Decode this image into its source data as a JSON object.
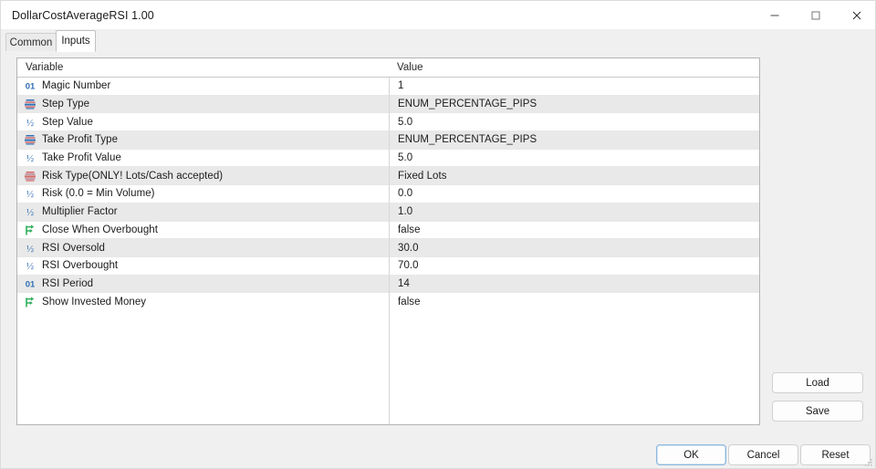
{
  "window": {
    "title": "DollarCostAverageRSI 1.00",
    "caption_buttons": [
      {
        "name": "minimize",
        "label": "—"
      },
      {
        "name": "maximize",
        "label": "□"
      },
      {
        "name": "close",
        "label": "✕"
      }
    ]
  },
  "tabs": [
    {
      "label": "Common",
      "active": false
    },
    {
      "label": "Inputs",
      "active": true
    }
  ],
  "table": {
    "headers": {
      "variable": "Variable",
      "value": "Value"
    },
    "rows": [
      {
        "icon": "int-type-icon",
        "variable": "Magic Number",
        "value": "1"
      },
      {
        "icon": "enum-type-icon",
        "variable": "Step Type",
        "value": "ENUM_PERCENTAGE_PIPS"
      },
      {
        "icon": "double-type-icon",
        "variable": "Step Value",
        "value": "5.0"
      },
      {
        "icon": "enum-type-icon",
        "variable": "Take Profit Type",
        "value": "ENUM_PERCENTAGE_PIPS"
      },
      {
        "icon": "double-type-icon",
        "variable": "Take Profit Value",
        "value": "5.0"
      },
      {
        "icon": "enum-red-type-icon",
        "variable": "Risk Type(ONLY! Lots/Cash accepted)",
        "value": "Fixed Lots"
      },
      {
        "icon": "double-type-icon",
        "variable": "Risk (0.0 = Min Volume)",
        "value": "0.0"
      },
      {
        "icon": "double-type-icon",
        "variable": "Multiplier Factor",
        "value": "1.0"
      },
      {
        "icon": "bool-type-icon",
        "variable": "Close When Overbought",
        "value": "false"
      },
      {
        "icon": "double-type-icon",
        "variable": "RSI Oversold",
        "value": "30.0"
      },
      {
        "icon": "double-type-icon",
        "variable": "RSI Overbought",
        "value": "70.0"
      },
      {
        "icon": "int-type-icon",
        "variable": "RSI Period",
        "value": "14"
      },
      {
        "icon": "bool-type-icon",
        "variable": "Show Invested Money",
        "value": "false"
      }
    ]
  },
  "side_buttons": [
    {
      "label": "Load"
    },
    {
      "label": "Save"
    }
  ],
  "footer_buttons": [
    {
      "label": "OK",
      "focused": true
    },
    {
      "label": "Cancel",
      "focused": false
    },
    {
      "label": "Reset",
      "focused": false
    }
  ],
  "colors": {
    "accent_blue": "#2f6fb5",
    "enum_red": "#d46a6a",
    "bool_green": "#2fae5a",
    "window_bg": "#f0f0f0",
    "table_bg": "#ffffff",
    "row_alt_bg": "#e9e9e9"
  }
}
